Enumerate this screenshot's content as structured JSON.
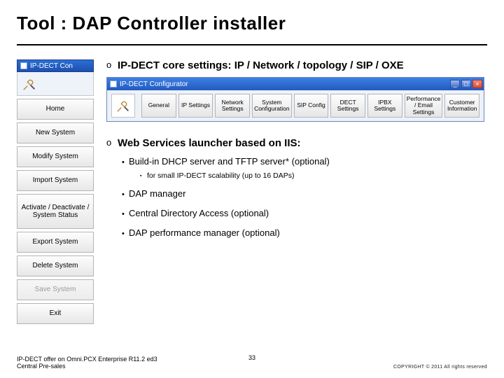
{
  "title": "Tool : DAP Controller installer",
  "left_toolbar": {
    "window_title": "IP-DECT Con",
    "buttons": [
      {
        "label": "Home",
        "state": "enabled"
      },
      {
        "label": "New System",
        "state": "enabled"
      },
      {
        "label": "Modify System",
        "state": "enabled"
      },
      {
        "label": "Import System",
        "state": "enabled"
      },
      {
        "label": "Activate / Deactivate / System Status",
        "state": "enabled",
        "tall": true
      },
      {
        "label": "Export System",
        "state": "enabled"
      },
      {
        "label": "Delete System",
        "state": "enabled"
      },
      {
        "label": "Save System",
        "state": "disabled"
      },
      {
        "label": "Exit",
        "state": "enabled"
      }
    ]
  },
  "bullets": {
    "core": "IP-DECT core settings:  IP / Network / topology / SIP / OXE",
    "web": "Web Services launcher based on IIS:"
  },
  "configurator": {
    "window_title": "IP-DECT Configurator",
    "tabs": [
      "General",
      "IP Settings",
      "Network Settings",
      "System Configuration",
      "SIP Config",
      "DECT Settings",
      "IPBX Settings",
      "Performance / Email Settings",
      "Customer Information"
    ]
  },
  "subitems": {
    "b1": "Build-in DHCP server and TFTP server* (optional)",
    "b1a": "for small IP-DECT scalability (up to 16 DAPs)",
    "b2": "DAP manager",
    "b3": "Central Directory Access (optional)",
    "b4": "DAP performance manager (optional)"
  },
  "footer": {
    "left1": "IP-DECT offer on Omni.PCX Enterprise R11.2 ed3",
    "left2": "Central Pre-sales",
    "page": "33",
    "copyright": "COPYRIGHT © 2011 All rights reserved"
  }
}
